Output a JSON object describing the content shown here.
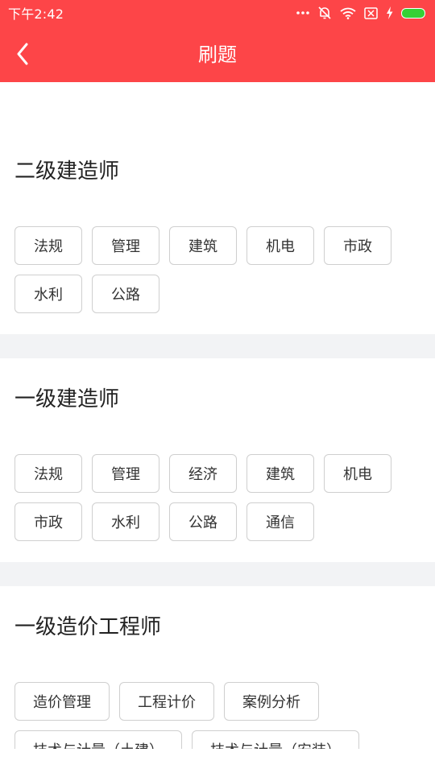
{
  "status_bar": {
    "time": "下午2:42",
    "icons": [
      "more-dots-icon",
      "notification-off-icon",
      "wifi-icon",
      "sim-card-icon",
      "charging-icon",
      "battery-icon"
    ],
    "bar_color": "#fd4548",
    "battery_color": "#35d135"
  },
  "header": {
    "title": "刷题",
    "back_icon": "chevron-left-icon",
    "color": "#fd4548"
  },
  "sections": [
    {
      "title": "二级建造师",
      "tags": [
        "法规",
        "管理",
        "建筑",
        "机电",
        "市政",
        "水利",
        "公路"
      ]
    },
    {
      "title": "一级建造师",
      "tags": [
        "法规",
        "管理",
        "经济",
        "建筑",
        "机电",
        "市政",
        "水利",
        "公路",
        "通信"
      ]
    },
    {
      "title": "一级造价工程师",
      "tags": [
        "造价管理",
        "工程计价",
        "案例分析",
        "技术与计量（土建）",
        "技术与计量（安装）"
      ]
    }
  ]
}
